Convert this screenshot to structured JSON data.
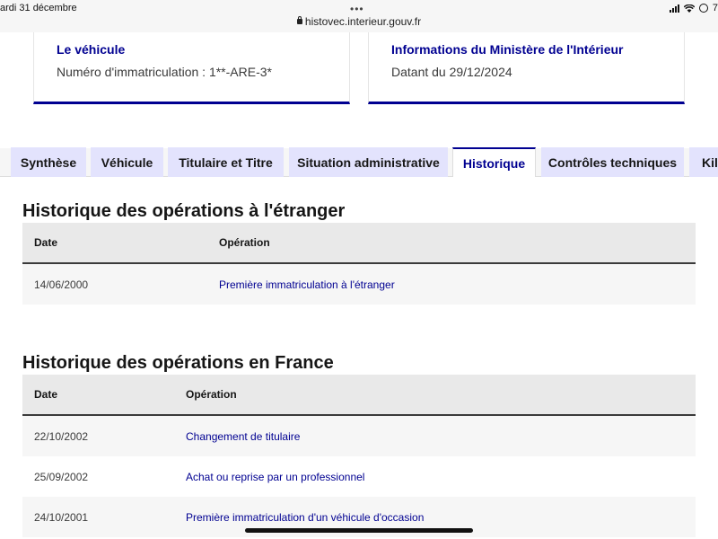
{
  "browser": {
    "status_date": "ardi 31 décembre",
    "status_right": "7",
    "url": "histovec.interieur.gouv.fr",
    "menu_dots": "•••"
  },
  "cards": {
    "vehicle": {
      "title": "Le véhicule",
      "text": "Numéro d'immatriculation : 1**-ARE-3*"
    },
    "ministry": {
      "title": "Informations du Ministère de l'Intérieur",
      "text": "Datant du 29/12/2024"
    }
  },
  "tabs": [
    {
      "label": "Synthèse",
      "active": false
    },
    {
      "label": "Véhicule",
      "active": false
    },
    {
      "label": "Titulaire et Titre",
      "active": false
    },
    {
      "label": "Situation administrative",
      "active": false
    },
    {
      "label": "Historique",
      "active": true
    },
    {
      "label": "Contrôles techniques",
      "active": false
    },
    {
      "label": "Kilo",
      "active": false
    }
  ],
  "foreign_history": {
    "title": "Historique des opérations à l'étranger",
    "headers": {
      "date": "Date",
      "operation": "Opération"
    },
    "rows": [
      {
        "date": "14/06/2000",
        "operation": "Première immatriculation à l'étranger"
      }
    ]
  },
  "france_history": {
    "title": "Historique des opérations en France",
    "headers": {
      "date": "Date",
      "operation": "Opération"
    },
    "rows": [
      {
        "date": "22/10/2002",
        "operation": "Changement de titulaire"
      },
      {
        "date": "25/09/2002",
        "operation": "Achat ou reprise par un professionnel"
      },
      {
        "date": "24/10/2001",
        "operation": "Première immatriculation d'un véhicule d'occasion"
      }
    ]
  },
  "colors": {
    "accent": "#000091",
    "tab_bg": "#e3e3fd",
    "header_bg": "#e9e9e9",
    "stripe_bg": "#f6f6f6"
  }
}
